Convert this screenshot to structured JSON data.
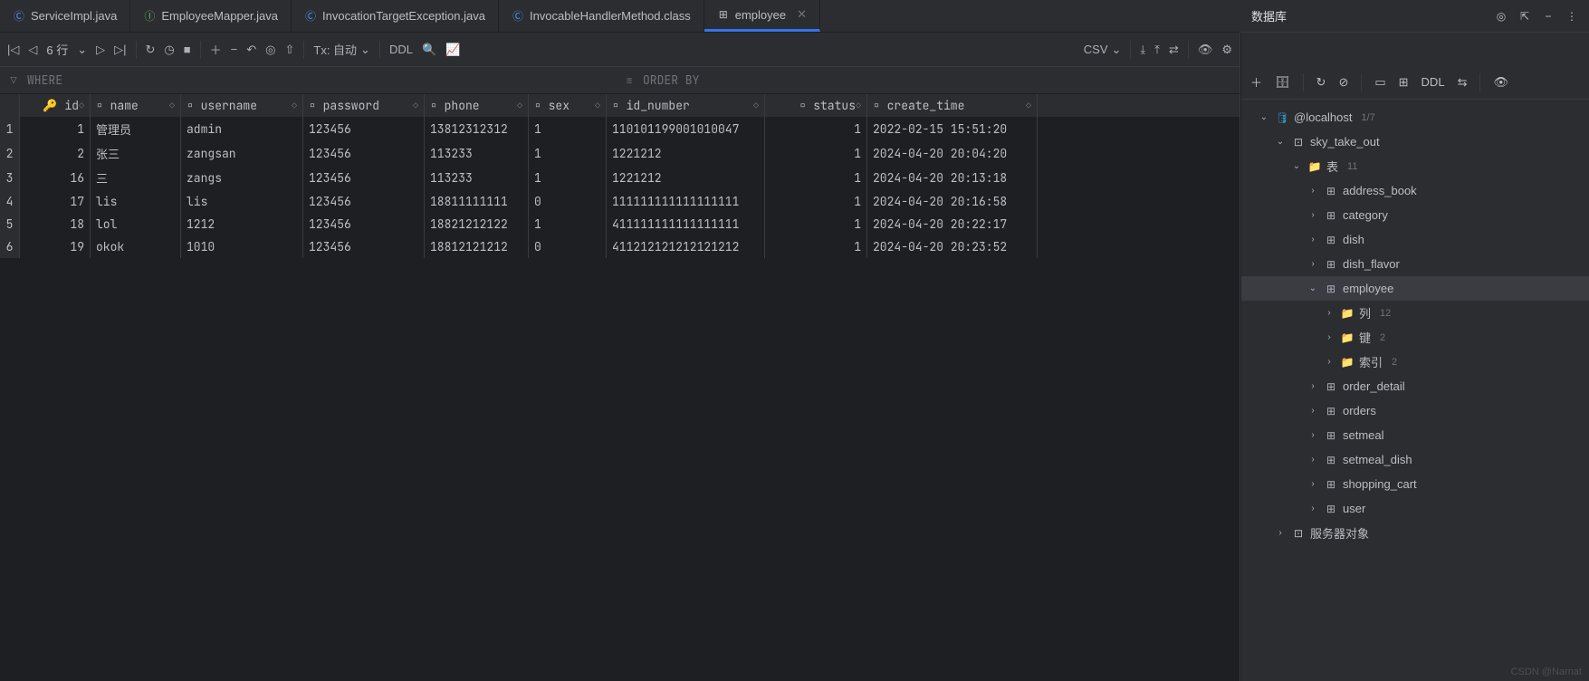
{
  "tabs": [
    {
      "label": "ServiceImpl.java",
      "icon": "C",
      "iconColor": "blue",
      "active": false
    },
    {
      "label": "EmployeeMapper.java",
      "icon": "I",
      "iconColor": "green",
      "active": false
    },
    {
      "label": "InvocationTargetException.java",
      "icon": "C",
      "iconColor": "blue",
      "active": false
    },
    {
      "label": "InvocableHandlerMethod.class",
      "icon": "C",
      "iconColor": "blue",
      "active": false
    },
    {
      "label": "employee",
      "icon": "⊞",
      "iconColor": "gray",
      "active": true,
      "closable": true
    }
  ],
  "toolbar": {
    "rowCount": "6 行",
    "tx": "Tx: 自动",
    "ddl": "DDL",
    "format": "CSV"
  },
  "filter": {
    "wherePlaceholder": "WHERE",
    "orderByPlaceholder": "ORDER BY"
  },
  "columns": [
    "id",
    "name",
    "username",
    "password",
    "phone",
    "sex",
    "id_number",
    "status",
    "create_time"
  ],
  "rows": [
    {
      "n": "1",
      "id": "1",
      "name": "管理员",
      "username": "admin",
      "password": "123456",
      "phone": "13812312312",
      "sex": "1",
      "id_number": "110101199001010047",
      "status": "1",
      "create_time": "2022-02-15 15:51:20"
    },
    {
      "n": "2",
      "id": "2",
      "name": "张三",
      "username": "zangsan",
      "password": "123456",
      "phone": "113233",
      "sex": "1",
      "id_number": "1221212",
      "status": "1",
      "create_time": "2024-04-20 20:04:20"
    },
    {
      "n": "3",
      "id": "16",
      "name": "三",
      "username": "zangs",
      "password": "123456",
      "phone": "113233",
      "sex": "1",
      "id_number": "1221212",
      "status": "1",
      "create_time": "2024-04-20 20:13:18"
    },
    {
      "n": "4",
      "id": "17",
      "name": "lis",
      "username": "lis",
      "password": "123456",
      "phone": "18811111111",
      "sex": "0",
      "id_number": "111111111111111111",
      "status": "1",
      "create_time": "2024-04-20 20:16:58"
    },
    {
      "n": "5",
      "id": "18",
      "name": "lol",
      "username": "1212",
      "password": "123456",
      "phone": "18821212122",
      "sex": "1",
      "id_number": "411111111111111111",
      "status": "1",
      "create_time": "2024-04-20 20:22:17"
    },
    {
      "n": "6",
      "id": "19",
      "name": "okok",
      "username": "1010",
      "password": "123456",
      "phone": "18812121212",
      "sex": "0",
      "id_number": "411212121212121212",
      "status": "1",
      "create_time": "2024-04-20 20:23:52"
    }
  ],
  "dbPanel": {
    "title": "数据库",
    "datasource": {
      "label": "@localhost",
      "count": "1/7"
    },
    "schema": "sky_take_out",
    "tablesLabel": "表",
    "tablesCount": "11",
    "tables": [
      "address_book",
      "category",
      "dish",
      "dish_flavor",
      "employee",
      "order_detail",
      "orders",
      "setmeal",
      "setmeal_dish",
      "shopping_cart",
      "user"
    ],
    "selectedTable": "employee",
    "employeeChildren": [
      {
        "label": "列",
        "count": "12"
      },
      {
        "label": "键",
        "count": "2"
      },
      {
        "label": "索引",
        "count": "2"
      }
    ],
    "serverObjects": "服务器对象"
  },
  "watermark": "CSDN @Narnat"
}
